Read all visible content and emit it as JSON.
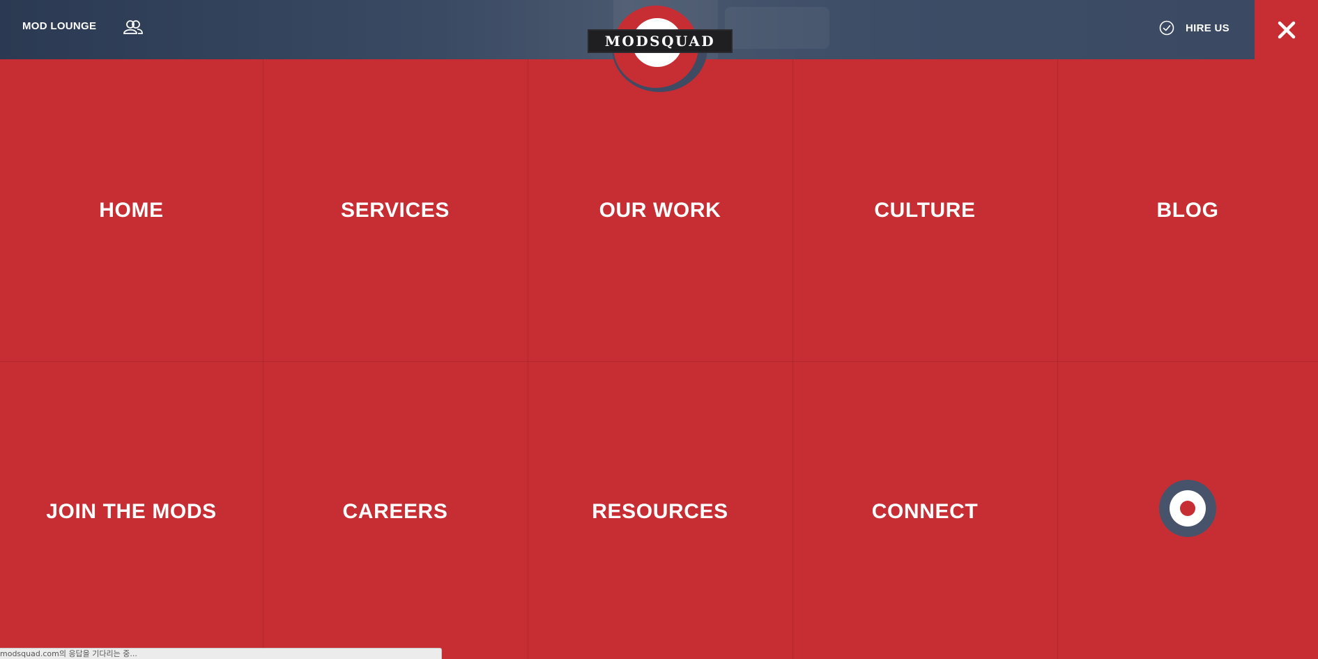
{
  "header": {
    "mod_lounge_label": "MOD LOUNGE",
    "lounge_icon": "people-icon",
    "hire_icon": "check-circle-icon",
    "hire_label": "HIRE US",
    "close_icon": "close-icon"
  },
  "logo": {
    "wordmark": "MODSQUAD"
  },
  "menu": {
    "items": [
      {
        "label": "HOME"
      },
      {
        "label": "SERVICES"
      },
      {
        "label": "OUR WORK"
      },
      {
        "label": "CULTURE"
      },
      {
        "label": "BLOG"
      },
      {
        "label": "JOIN THE MODS"
      },
      {
        "label": "CAREERS"
      },
      {
        "label": "RESOURCES"
      },
      {
        "label": "CONNECT"
      }
    ],
    "emblem_icon": "mod-target-icon"
  },
  "status_bar": {
    "text": "modsquad.com의 응답을 기다리는 중..."
  },
  "colors": {
    "menu_red": "#c62e33",
    "header_navy": "#2b3a52",
    "target_navy": "#47536b"
  }
}
